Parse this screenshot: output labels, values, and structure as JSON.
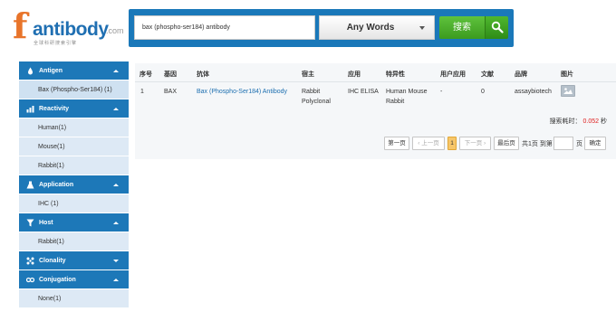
{
  "logo": {
    "f": "f",
    "word": "antibody",
    "com": ".com",
    "slogan": "全球科研搜索引擎"
  },
  "search": {
    "query": "bax (phospho-ser184) antibody",
    "mode": "Any Words",
    "button": "搜索"
  },
  "sidebar": [
    {
      "icon": "antigen-drop-icon",
      "label": "Antigen",
      "expanded": true,
      "items": [
        "Bax (Phospho-Ser184) (1)"
      ]
    },
    {
      "icon": "reactivity-chart-icon",
      "label": "Reactivity",
      "expanded": true,
      "items": [
        "Human(1)",
        "Mouse(1)",
        "Rabbit(1)"
      ]
    },
    {
      "icon": "application-flask-icon",
      "label": "Application",
      "expanded": true,
      "items": [
        "IHC (1)"
      ]
    },
    {
      "icon": "host-filter-icon",
      "label": "Host",
      "expanded": true,
      "items": [
        "Rabbit(1)"
      ]
    },
    {
      "icon": "clonality-icon",
      "label": "Clonality",
      "expanded": false,
      "items": []
    },
    {
      "icon": "conjugation-icon",
      "label": "Conjugation",
      "expanded": true,
      "items": [
        "None(1)"
      ]
    }
  ],
  "table": {
    "headers": [
      "序号",
      "基因",
      "抗体",
      "宿主",
      "应用",
      "特异性",
      "用户应用",
      "文献",
      "品牌",
      "图片"
    ],
    "rows": [
      {
        "index": "1",
        "gene": "BAX",
        "antibody": "Bax (Phospho-Ser184) Antibody",
        "host_line1": "Rabbit",
        "host_line2": "Polyclonal",
        "application": "IHC ELISA",
        "specificity_line1": "Human Mouse",
        "specificity_line2": "Rabbit",
        "user_application": "-",
        "citations": "0",
        "brand": "assaybiotech"
      }
    ]
  },
  "timing": {
    "label": "搜索耗时：",
    "value": "0.052",
    "unit": "秒"
  },
  "pager": {
    "first": "第一页",
    "prev": "上一页",
    "current": "1",
    "next": "下一页",
    "last": "最后页",
    "total_text": "共1页 到第",
    "page_unit": "页",
    "go": "确定"
  }
}
